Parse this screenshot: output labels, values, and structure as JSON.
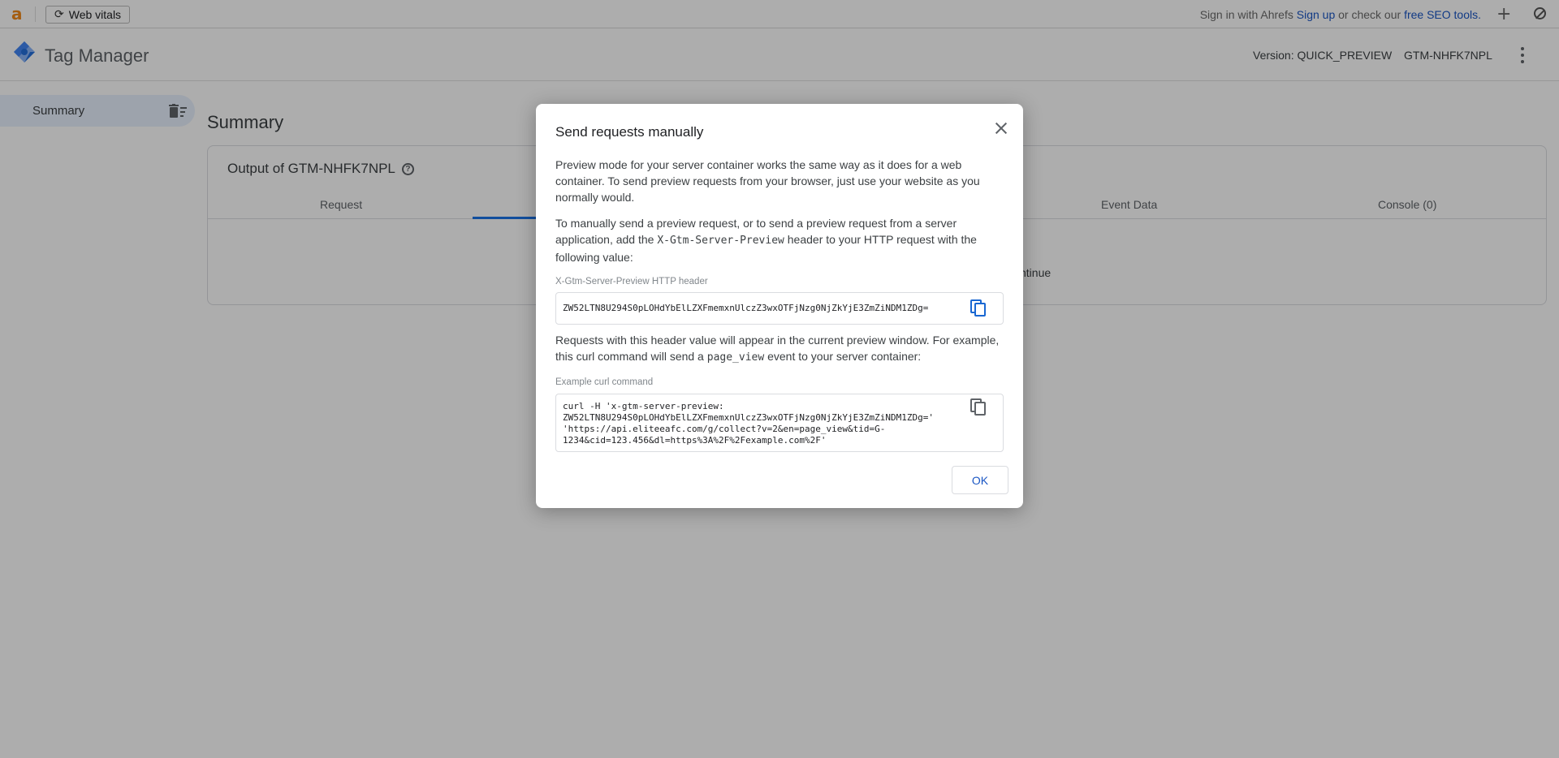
{
  "extension_bar": {
    "web_vitals_label": "Web vitals",
    "sign_in_text": "Sign in with Ahrefs",
    "sign_up_link": "Sign up",
    "or_check_text": "or check our",
    "free_tools_link": "free SEO tools."
  },
  "header": {
    "app_title": "Tag Manager",
    "version": "Version: QUICK_PREVIEW",
    "container_id": "GTM-NHFK7NPL"
  },
  "sidebar": {
    "items": [
      {
        "label": "Summary"
      }
    ]
  },
  "main": {
    "title": "Summary",
    "card_title": "Output of GTM-NHFK7NPL",
    "tabs": [
      {
        "label": "Request"
      },
      {
        "label": "Event Data"
      },
      {
        "label": "Console (0)"
      }
    ],
    "partial_text": "ntinue"
  },
  "dialog": {
    "title": "Send requests manually",
    "para1": "Preview mode for your server container works the same way as it does for a web container. To send preview requests from your browser, just use your website as you normally would.",
    "para2_a": "To manually send a preview request, or to send a preview request from a server application, add the ",
    "para2_code": "X-Gtm-Server-Preview",
    "para2_b": " header to your HTTP request with the following value:",
    "header_label": "X-Gtm-Server-Preview HTTP header",
    "header_value": "ZW52LTN8U294S0pLOHdYbElLZXFmemxnUlczZ3wxOTFjNzg0NjZkYjE3ZmZiNDM1ZDg=",
    "para3_a": "Requests with this header value will appear in the current preview window. For example, this curl command will send a ",
    "para3_code": "page_view",
    "para3_b": " event to your server container:",
    "curl_label": "Example curl command",
    "curl_lines": [
      "curl -H 'x-gtm-server-preview:",
      "ZW52LTN8U294S0pLOHdYbElLZXFmemxnUlczZ3wxOTFjNzg0NjZkYjE3ZmZiNDM1ZDg='",
      "'https://api.eliteeafc.com/g/collect?v=2&en=page_view&tid=G-",
      "1234&cid=123.456&dl=https%3A%2F%2Fexample.com%2F'"
    ],
    "ok_label": "OK"
  },
  "colors": {
    "accent": "#1a73e8",
    "link": "#1a56c4",
    "ahrefs_orange": "#f28a1a"
  }
}
